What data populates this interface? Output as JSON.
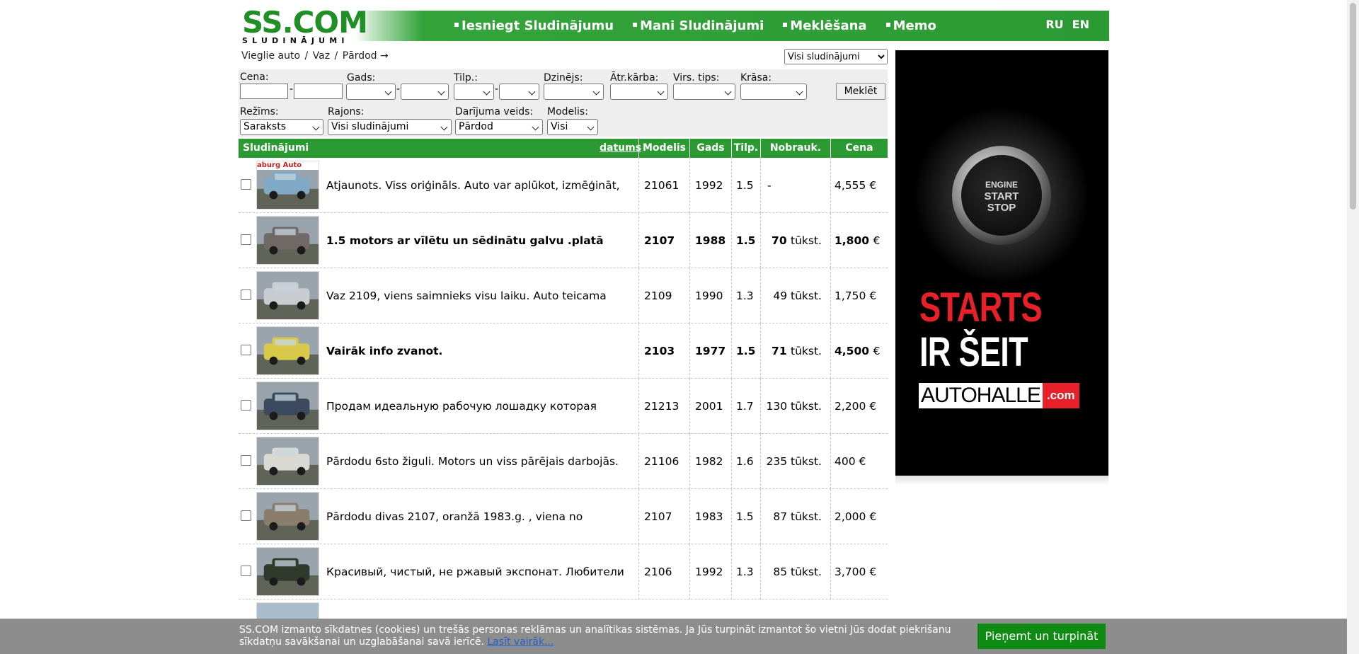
{
  "header": {
    "logo": "SS.COM",
    "logo_sub": "SLUDINĀJUMI",
    "nav": [
      "Iesniegt Sludinājumu",
      "Mani Sludinājumi",
      "Meklēšana",
      "Memo"
    ],
    "lang": [
      "RU",
      "EN"
    ]
  },
  "breadcrumb": {
    "items": [
      "Vieglie auto",
      "Vaz",
      "Pārdod"
    ],
    "arrow": "→"
  },
  "top_select": {
    "value": "Visi sludinājumi"
  },
  "filters": {
    "price_label": "Cena:",
    "year_label": "Gads:",
    "volume_label": "Tilp.:",
    "engine_label": "Dzinējs:",
    "gearbox_label": "Ātr.kārba:",
    "body_label": "Virs. tips:",
    "color_label": "Krāsa:",
    "mode_label": "Režīms:",
    "mode_value": "Saraksts",
    "region_label": "Rajons:",
    "region_value": "Visi sludinājumi",
    "deal_label": "Darījuma veids:",
    "deal_value": "Pārdod",
    "model_label": "Modelis:",
    "model_value": "Visi",
    "dash": "-",
    "search_button": "Meklēt"
  },
  "table": {
    "headers": {
      "ads": "Sludinājumi",
      "date": "datums",
      "model": "Modelis",
      "year": "Gads",
      "volume": "Tilp.",
      "mileage": "Nobrauk.",
      "price": "Cena"
    },
    "rows": [
      {
        "title": "Atjaunots. Viss oriģināls. Auto var aplūkot, izmēģināt,",
        "model": "21061",
        "year": "1992",
        "volume": "1.5",
        "mileage": "-",
        "mileage_unit": "",
        "price": "4,555",
        "currency": "€",
        "bold": false,
        "thumb_color": "#7fa9c4",
        "thumb_banner": "aburg Auto"
      },
      {
        "title": "1.5 motors ar vīlētu un sēdinātu galvu .platā",
        "model": "2107",
        "year": "1988",
        "volume": "1.5",
        "mileage": "70",
        "mileage_unit": "tūkst.",
        "price": "1,800",
        "currency": "€",
        "bold": true,
        "thumb_color": "#6f6a66"
      },
      {
        "title": "Vaz 2109, viens saimnieks visu laiku. Auto teicama",
        "model": "2109",
        "year": "1990",
        "volume": "1.3",
        "mileage": "49",
        "mileage_unit": "tūkst.",
        "price": "1,750",
        "currency": "€",
        "bold": false,
        "thumb_color": "#c9ccd1"
      },
      {
        "title": "Vairāk info zvanot.",
        "model": "2103",
        "year": "1977",
        "volume": "1.5",
        "mileage": "71",
        "mileage_unit": "tūkst.",
        "price": "4,500",
        "currency": "€",
        "bold": true,
        "thumb_color": "#d8c94a"
      },
      {
        "title": "Продам идеальную рабочую лошадку которая",
        "model": "21213",
        "year": "2001",
        "volume": "1.7",
        "mileage": "130",
        "mileage_unit": "tūkst.",
        "price": "2,200",
        "currency": "€",
        "bold": false,
        "thumb_color": "#3b4a5e"
      },
      {
        "title": "Pārdodu 6sto žiguli. Motors un viss pārējais darbojās.",
        "model": "21106",
        "year": "1982",
        "volume": "1.6",
        "mileage": "235",
        "mileage_unit": "tūkst.",
        "price": "400",
        "currency": "€",
        "bold": false,
        "thumb_color": "#d9d8d2"
      },
      {
        "title": "Pārdodu divas 2107, oranžā 1983.g. , viena no",
        "model": "2107",
        "year": "1983",
        "volume": "1.5",
        "mileage": "87",
        "mileage_unit": "tūkst.",
        "price": "2,000",
        "currency": "€",
        "bold": false,
        "thumb_color": "#8b7d6b"
      },
      {
        "title": "Красивый, чистый, не ржавый экспонат. Любители",
        "model": "2106",
        "year": "1992",
        "volume": "1.3",
        "mileage": "85",
        "mileage_unit": "tūkst.",
        "price": "3,700",
        "currency": "€",
        "bold": false,
        "thumb_color": "#2f3a2c"
      }
    ]
  },
  "banner": {
    "button_line1": "ENGINE",
    "button_line2": "START",
    "button_line3": "STOP",
    "headline1": "STARTS",
    "headline2": "IR ŠEIT",
    "brand": "AUTOHALLE",
    "brand_suffix": ".com"
  },
  "cookie": {
    "text": "SS.COM izmanto sīkdatnes (cookies) un trešās personas reklāmas un analītikas sistēmas. Ja Jūs turpināt izmantot šo vietni Jūs dodat piekrišanu sīkdatņu savākšanai un uzglabāšanai savā ierīcē.",
    "link": "Lasīt vairāk...",
    "button": "Pieņemt un turpināt"
  },
  "colors": {
    "brand_green": "#2c9a33",
    "logo_green": "#1f8f26",
    "accent_red": "#e8202a",
    "cookie_button": "#0f8a12"
  }
}
